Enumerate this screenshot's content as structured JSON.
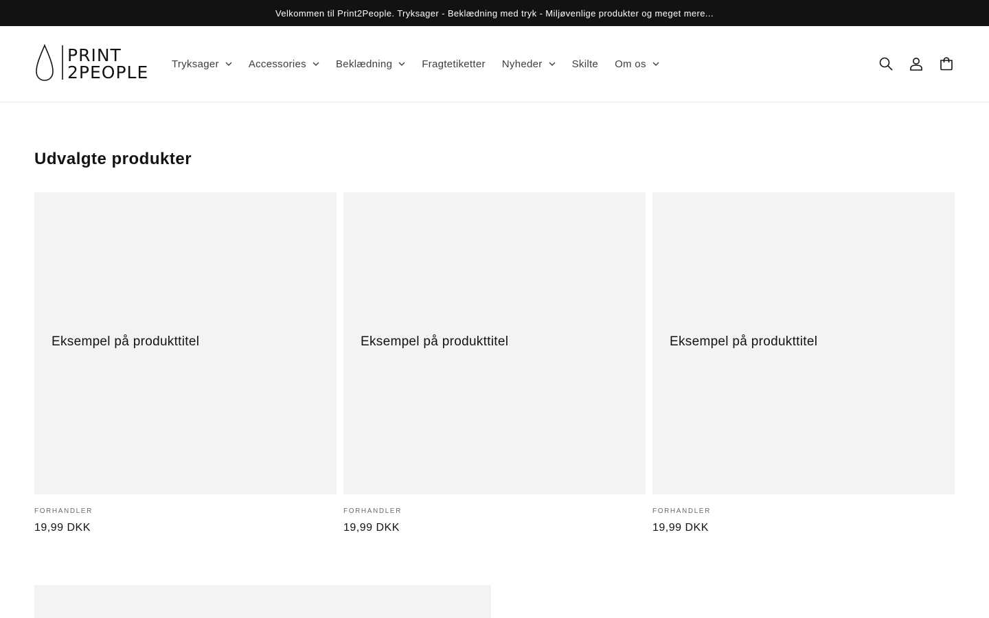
{
  "announcement": {
    "text": "Velkommen til Print2People. Tryksager - Beklædning med tryk - Miljøvenlige produkter og meget mere..."
  },
  "header": {
    "logo": {
      "line1": "PRINT",
      "line2": "2PEOPLE",
      "icon": "drop-logo-icon"
    },
    "nav": [
      {
        "label": "Tryksager",
        "has_dropdown": true
      },
      {
        "label": "Accessories",
        "has_dropdown": true
      },
      {
        "label": "Beklædning",
        "has_dropdown": true
      },
      {
        "label": "Fragtetiketter",
        "has_dropdown": false
      },
      {
        "label": "Nyheder",
        "has_dropdown": true
      },
      {
        "label": "Skilte",
        "has_dropdown": false
      },
      {
        "label": "Om os",
        "has_dropdown": true
      }
    ],
    "icons": [
      "search-icon",
      "account-icon",
      "cart-icon"
    ]
  },
  "featured": {
    "title": "Udvalgte produkter",
    "products": [
      {
        "title": "Eksempel på produkttitel",
        "vendor": "FORHANDLER",
        "price": "19,99 DKK"
      },
      {
        "title": "Eksempel på produkttitel",
        "vendor": "FORHANDLER",
        "price": "19,99 DKK"
      },
      {
        "title": "Eksempel på produkttitel",
        "vendor": "FORHANDLER",
        "price": "19,99 DKK"
      }
    ]
  },
  "colors": {
    "announcement_bg": "#121212",
    "text": "#121212",
    "placeholder_bg": "#f3f3f3",
    "nav_text": "#3d3d3d"
  }
}
